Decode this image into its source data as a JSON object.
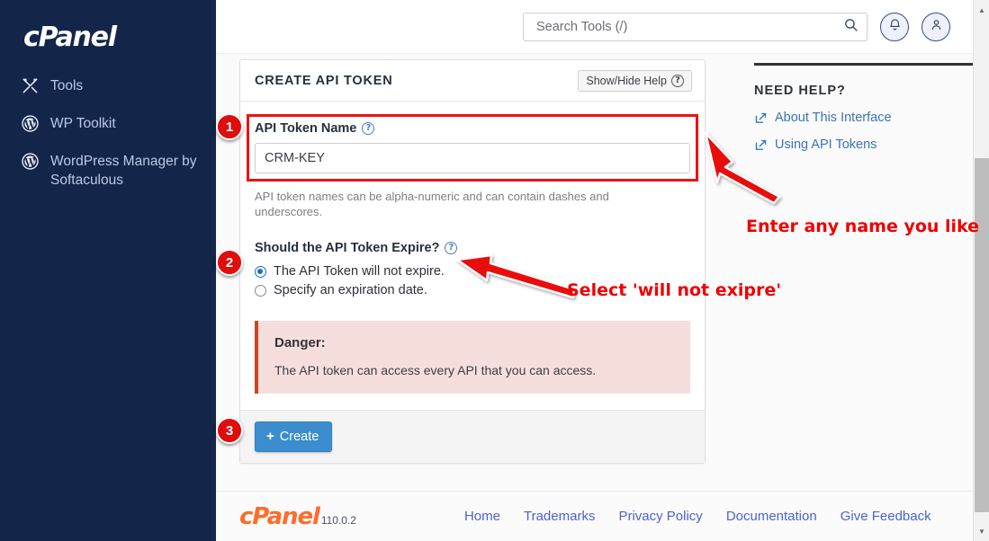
{
  "sidebar": {
    "brand": "cPanel",
    "items": [
      {
        "label": "Tools",
        "icon": "tools-icon"
      },
      {
        "label": "WP Toolkit",
        "icon": "wordpress-icon"
      },
      {
        "label": "WordPress Manager by Softaculous",
        "icon": "wordpress-icon"
      }
    ]
  },
  "header": {
    "search_placeholder": "Search Tools (/)",
    "search_value": "",
    "notifications_icon": "bell-icon",
    "account_icon": "user-icon"
  },
  "card": {
    "title": "CREATE API TOKEN",
    "help_toggle": "Show/Hide Help",
    "token_name_label": "API Token Name",
    "token_name_value": "CRM-KEY",
    "token_name_hint": "API token names can be alpha-numeric and can contain dashes and underscores.",
    "expire_label": "Should the API Token Expire?",
    "radios": [
      {
        "label": "The API Token will not expire.",
        "checked": true
      },
      {
        "label": "Specify an expiration date.",
        "checked": false
      }
    ],
    "danger_title": "Danger:",
    "danger_text": "The API token can access every API that you can access.",
    "create_label": "Create",
    "create_icon": "plus-icon"
  },
  "help": {
    "title": "NEED HELP?",
    "links": [
      {
        "label": "About This Interface",
        "icon": "external-link-icon"
      },
      {
        "label": "Using API Tokens",
        "icon": "external-link-icon"
      }
    ]
  },
  "footer": {
    "logo": "cPanel",
    "version": "110.0.2",
    "links": [
      "Home",
      "Trademarks",
      "Privacy Policy",
      "Documentation",
      "Give Feedback"
    ]
  },
  "annotations": {
    "badges": [
      "1",
      "2",
      "3"
    ],
    "note_name": "Enter any name you like",
    "note_expire": "Select 'will not exipre'"
  },
  "colors": {
    "sidebar_bg": "#13264a",
    "accent_red": "#ef0000",
    "primary_button": "#3c8dcd",
    "link_blue": "#3a74b5",
    "danger_bg": "#f6dedd",
    "danger_bar": "#d0431c",
    "cpanel_orange": "#ff6c2c"
  }
}
